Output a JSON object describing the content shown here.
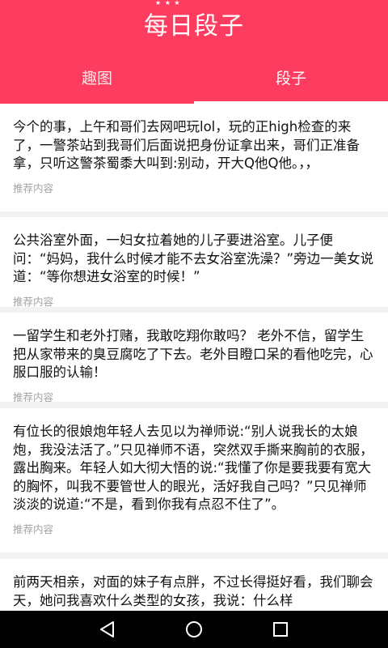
{
  "header": {
    "title": "每日段子",
    "title_stars": "★ ★ ★",
    "accent_color": "#fc3d5f"
  },
  "tabs": [
    {
      "label": "趣图",
      "active": false
    },
    {
      "label": "段子",
      "active": true
    }
  ],
  "feed": {
    "items": [
      {
        "text": "今个的事，上午和哥们去网吧玩lol，玩的正high检查的来了，一警茶站到我哥们后面说把身份证拿出来，哥们正准备拿，只听这警茶蜀黍大叫到:别动，开大Q他Q他。，，",
        "tag": "推荐内容"
      },
      {
        "text": "公共浴室外面，一妇女拉着她的儿子要进浴室。儿子便问：“妈妈，我什么时候才能不去女浴室洗澡？”旁边一美女说道：“等你想进女浴室的时候！”",
        "tag": "推荐内容"
      },
      {
        "text": "一留学生和老外打赌，我敢吃翔你敢吗？ 老外不信，留学生把从家带来的臭豆腐吃了下去。老外目瞪口呆的看他吃完，心服口服的认输！",
        "tag": "推荐内容"
      },
      {
        "text": "有位长的很娘炮年轻人去见以为禅师说:“别人说我长的太娘炮，我没法活了。”只见禅师不语，突然双手撕来胸前的衣服，露出胸来。年轻人如大彻大悟的说:“我懂了你是要我要有宽大的胸怀，叫我不要管世人的眼光，活好我自己吗？”只见禅师淡淡的说道:“不是，看到你我有点忍不住了”。",
        "tag": "推荐内容"
      },
      {
        "text": "前两天相亲，对面的妹子有点胖，不过长得挺好看，我们聊会天，她问我喜欢什么类型的女孩，我说：什么样",
        "tag": ""
      }
    ]
  },
  "nav": {
    "back": "back-icon",
    "home": "home-icon",
    "recents": "recents-icon"
  }
}
